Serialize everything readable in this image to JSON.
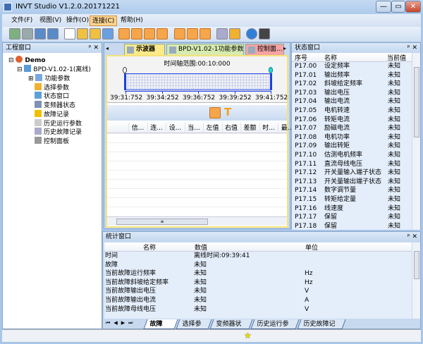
{
  "window": {
    "title": "INVT Studio V1.2.0.20171221",
    "minimize": "—",
    "maximize": "▭",
    "close": "✕"
  },
  "menu": [
    "文件(F)",
    "视图(V)",
    "操作(O)",
    "连接(C)",
    "帮助(H)"
  ],
  "menu_active": "连接(C)",
  "toolbar_icons": [
    "new-project-icon",
    "remove-project-icon",
    "connect-icon",
    "disconnect-icon",
    "window-icon",
    "add-folder-icon",
    "remove-folder-icon",
    "copy-icon",
    "oscilloscope-icon",
    "status-icon",
    "fault-icon",
    "select-param-icon",
    "bar-chart-icon",
    "param-list-icon",
    "history-icon",
    "book-icon",
    "search-icon",
    "help-icon",
    "exit-icon"
  ],
  "project_panel": {
    "title": "工程窗口",
    "pin": "ᵖ",
    "close": "✕",
    "root": "Demo",
    "device": "BPD-V1.02-1(离线)",
    "items": [
      "功能参数",
      "选择参数",
      "状态窗口",
      "变频器状态",
      "故障记录",
      "历史运行参数",
      "历史故障记录",
      "控制面板"
    ]
  },
  "center": {
    "tabs": [
      "示波器",
      "BPD-V1.02-1功能参数",
      "控制面..."
    ],
    "active_tab": "示波器",
    "scope": {
      "range_label": "时间轴范围:00:10:000",
      "ticks": [
        "39:31:752",
        "39:34:252",
        "39:36:752",
        "39:39:252",
        "39:41:752"
      ]
    },
    "columns": [
      "",
      "信...",
      "连...",
      "设...",
      "当...",
      "左值",
      "右值",
      "差额",
      "时...",
      "最..."
    ],
    "scroll_grip": "≡"
  },
  "status_panel": {
    "title": "状态窗口",
    "pin": "ᵖ",
    "close": "✕",
    "columns": [
      "序号",
      "名称",
      "当前值"
    ],
    "rows": [
      [
        "P17.00",
        "设定频率",
        "未知"
      ],
      [
        "P17.01",
        "输出频率",
        "未知"
      ],
      [
        "P17.02",
        "斜坡给定频率",
        "未知"
      ],
      [
        "P17.03",
        "输出电压",
        "未知"
      ],
      [
        "P17.04",
        "输出电流",
        "未知"
      ],
      [
        "P17.05",
        "电机转速",
        "未知"
      ],
      [
        "P17.06",
        "转矩电流",
        "未知"
      ],
      [
        "P17.07",
        "励磁电流",
        "未知"
      ],
      [
        "P17.08",
        "电机功率",
        "未知"
      ],
      [
        "P17.09",
        "输出转矩",
        "未知"
      ],
      [
        "P17.10",
        "估测电机频率",
        "未知"
      ],
      [
        "P17.11",
        "直流母线电压",
        "未知"
      ],
      [
        "P17.12",
        "开关量输入端子状态",
        "未知"
      ],
      [
        "P17.13",
        "开关量输出端子状态",
        "未知"
      ],
      [
        "P17.14",
        "数字调节量",
        "未知"
      ],
      [
        "P17.15",
        "转矩给定量",
        "未知"
      ],
      [
        "P17.16",
        "线速度",
        "未知"
      ],
      [
        "P17.17",
        "保留",
        "未知"
      ],
      [
        "P17.18",
        "保留",
        "未知"
      ]
    ]
  },
  "stats_panel": {
    "title": "统计窗口",
    "pin": "ᵖ",
    "close": "✕",
    "columns": [
      "名称",
      "数值",
      "单位"
    ],
    "rows": [
      [
        "时间",
        "离线时间:09:39:41",
        ""
      ],
      [
        "故障",
        "未知",
        ""
      ],
      [
        "当前故障运行频率",
        "未知",
        "Hz"
      ],
      [
        "当前故障斜坡给定频率",
        "未知",
        "Hz"
      ],
      [
        "当前故障输出电压",
        "未知",
        "V"
      ],
      [
        "当前故障输出电流",
        "未知",
        "A"
      ],
      [
        "当前故障母线电压",
        "未知",
        "V"
      ]
    ],
    "nav": [
      "⏮",
      "◀",
      "▶",
      "⏭"
    ],
    "tabs": [
      "故障记录",
      "选择参数",
      "变频器状态",
      "历史运行参数",
      "历史故障记录"
    ],
    "active_tab": "故障记录"
  },
  "statusbar": {
    "icon": "★"
  },
  "colors": {
    "accent": "#f6a64a",
    "frame": "#a9c6e8",
    "scope_line": "#1f3fe0"
  }
}
